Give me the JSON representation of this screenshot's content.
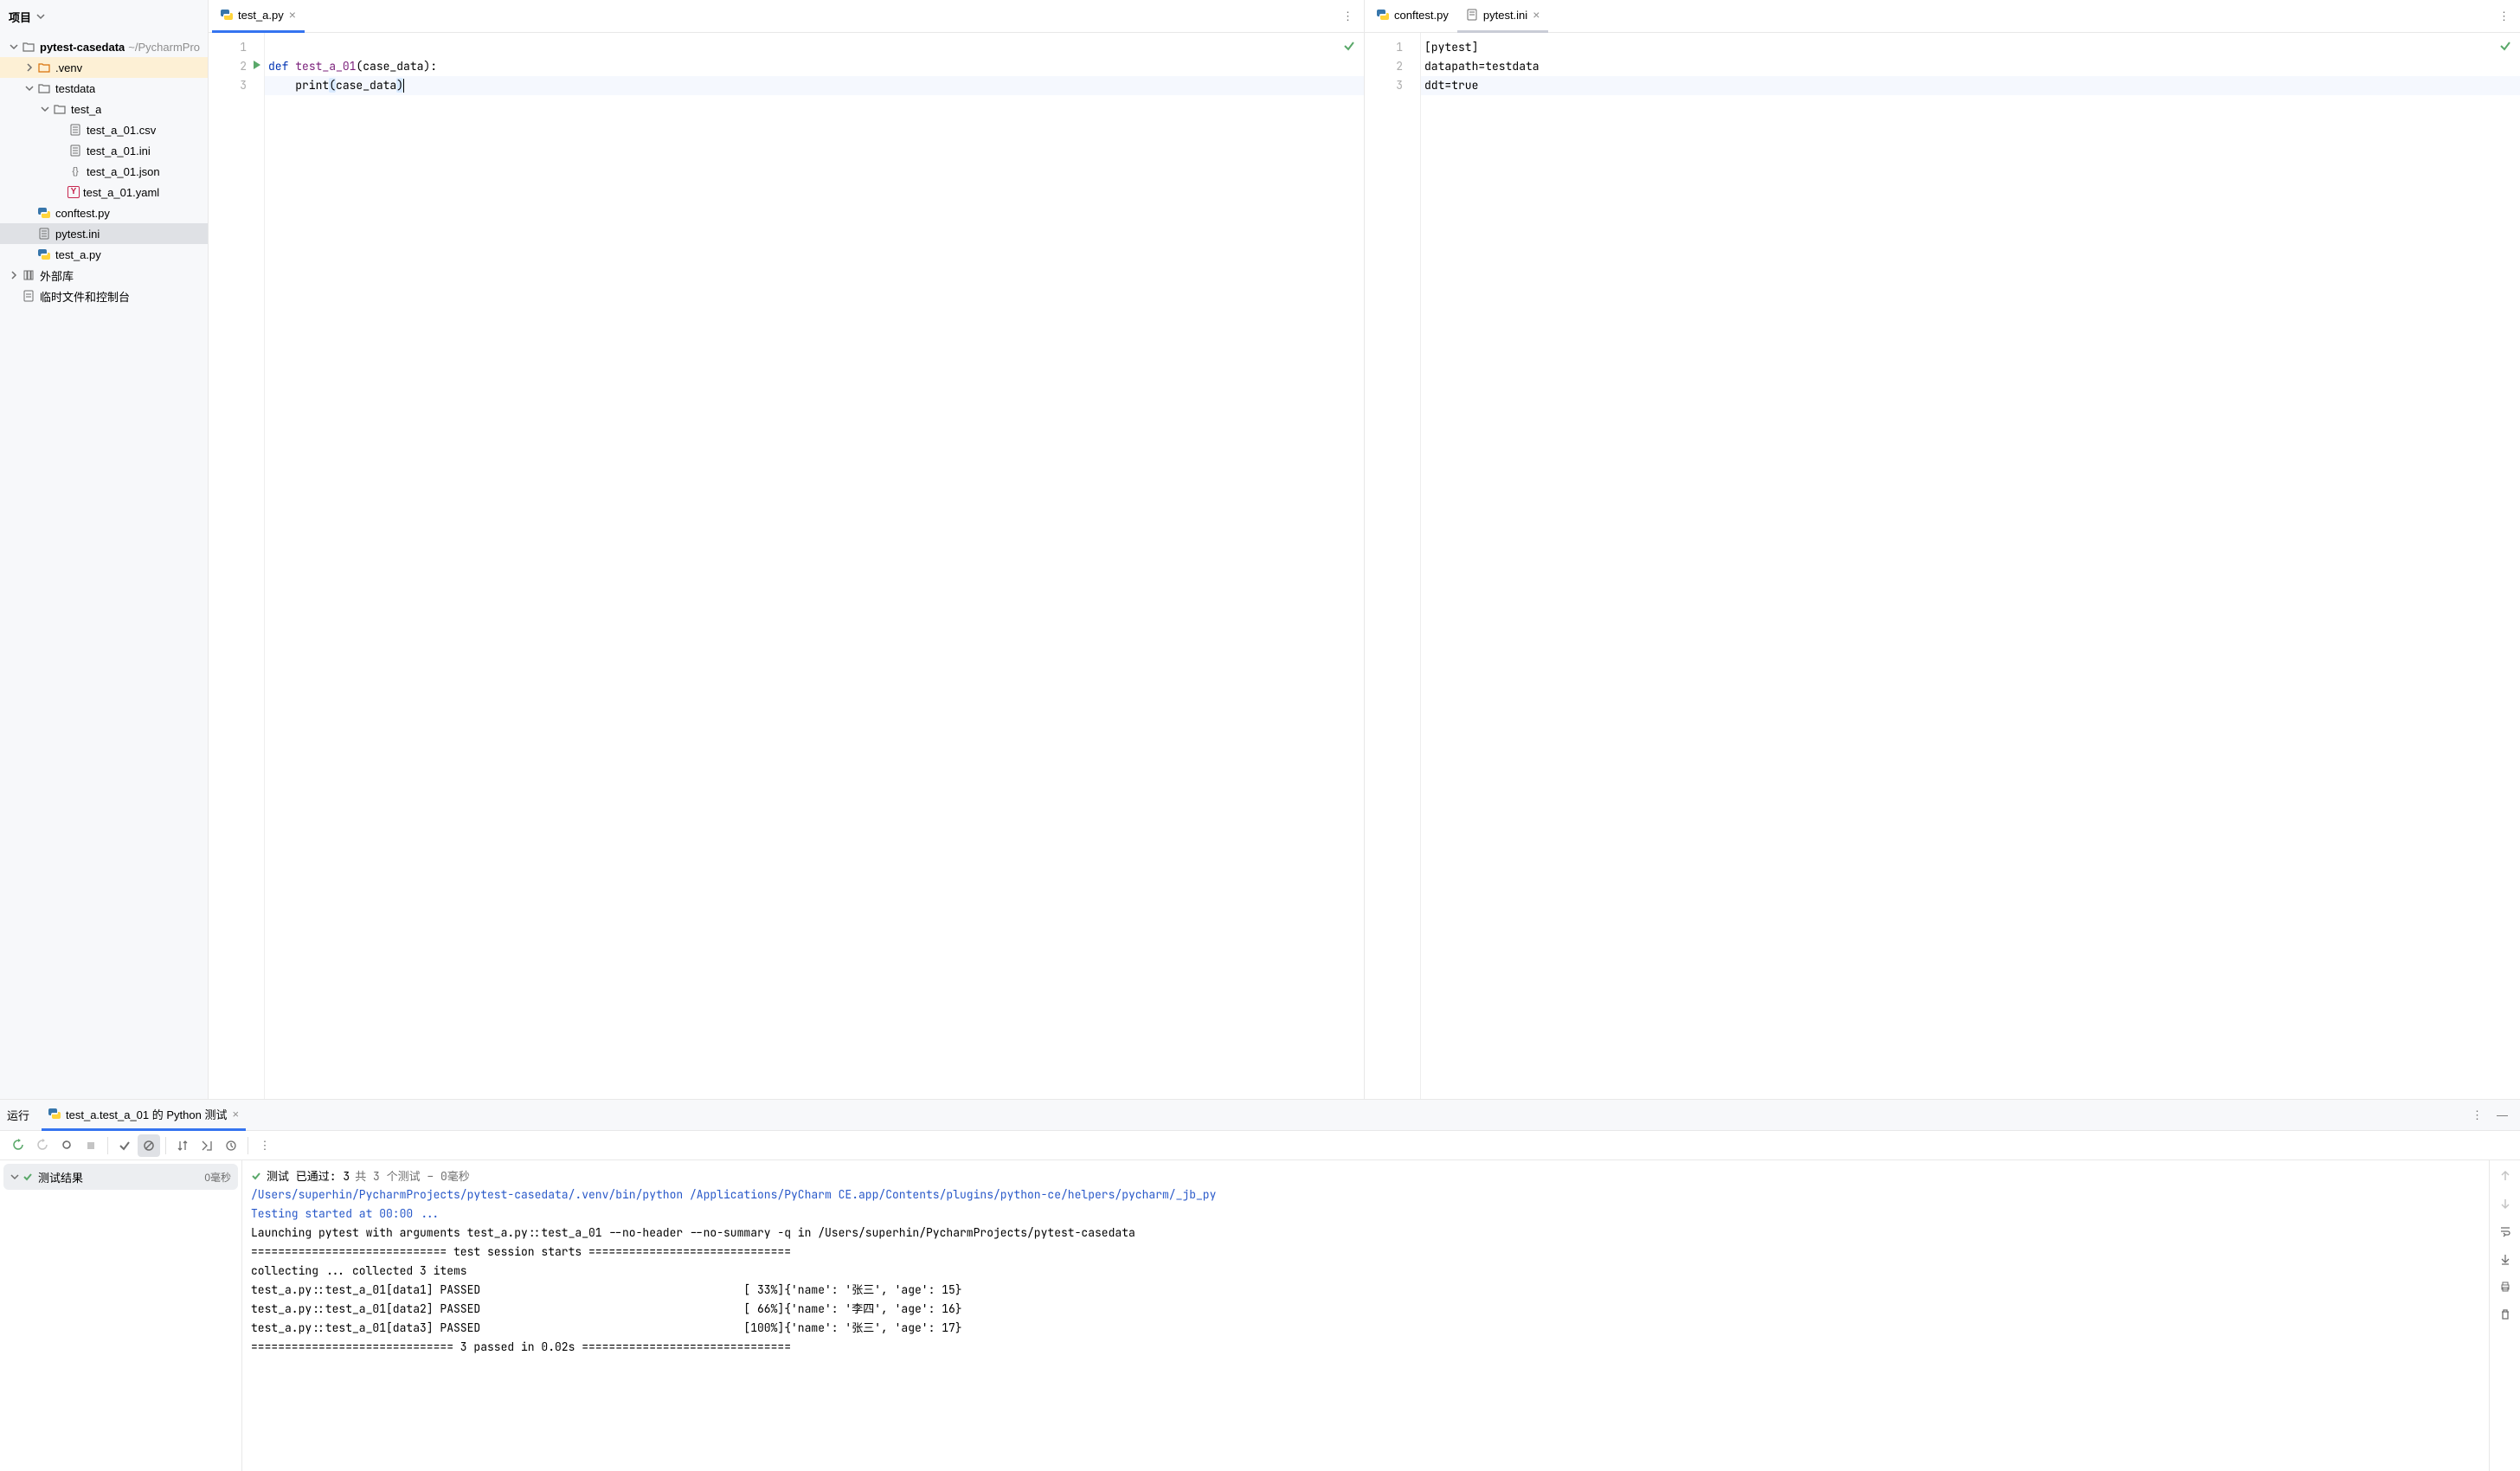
{
  "sidebar": {
    "title": "项目",
    "root": {
      "name": "pytest-casedata",
      "path": "~/PycharmPro"
    },
    "items": [
      {
        "label": ".venv"
      },
      {
        "label": "testdata"
      },
      {
        "label": "test_a"
      },
      {
        "label": "test_a_01.csv"
      },
      {
        "label": "test_a_01.ini"
      },
      {
        "label": "test_a_01.json"
      },
      {
        "label": "test_a_01.yaml"
      },
      {
        "label": "conftest.py"
      },
      {
        "label": "pytest.ini"
      },
      {
        "label": "test_a.py"
      },
      {
        "label": "外部库"
      },
      {
        "label": "临时文件和控制台"
      }
    ]
  },
  "editor_left": {
    "tab": "test_a.py",
    "lines": {
      "l1_num": "1",
      "l2_num": "2",
      "l3_num": "3",
      "l2_def": "def",
      "l2_fn": "test_a_01",
      "l2_args": "(case_data):",
      "l3_print": "print",
      "l3_open": "(",
      "l3_arg": "case_data",
      "l3_close": ")"
    }
  },
  "editor_right": {
    "tab1": "conftest.py",
    "tab2": "pytest.ini",
    "lines": {
      "l1_num": "1",
      "l1": "[pytest]",
      "l2_num": "2",
      "l2": "datapath=testdata",
      "l3_num": "3",
      "l3": "ddt=true"
    }
  },
  "run": {
    "title": "运行",
    "tab": "test_a.test_a_01 的 Python 测试",
    "results_label": "测试结果",
    "results_time": "0毫秒",
    "status_prefix": "测试 已通过: 3",
    "status_suffix": "共 3 个测试 – 0毫秒",
    "console": [
      {
        "cls": "blue",
        "text": "/Users/superhin/PycharmProjects/pytest-casedata/.venv/bin/python /Applications/PyCharm CE.app/Contents/plugins/python-ce/helpers/pycharm/_jb_py"
      },
      {
        "cls": "blue",
        "text": "Testing started at 00:00 ..."
      },
      {
        "cls": "",
        "text": "Launching pytest with arguments test_a.py::test_a_01 --no-header --no-summary -q in /Users/superhin/PycharmProjects/pytest-casedata"
      },
      {
        "cls": "",
        "text": ""
      },
      {
        "cls": "",
        "text": "============================= test session starts =============================="
      },
      {
        "cls": "",
        "text": "collecting ... collected 3 items"
      },
      {
        "cls": "",
        "text": ""
      },
      {
        "cls": "",
        "text": "test_a.py::test_a_01[data1] PASSED                                       [ 33%]{'name': '张三', 'age': 15}"
      },
      {
        "cls": "",
        "text": ""
      },
      {
        "cls": "",
        "text": "test_a.py::test_a_01[data2] PASSED                                       [ 66%]{'name': '李四', 'age': 16}"
      },
      {
        "cls": "",
        "text": ""
      },
      {
        "cls": "",
        "text": "test_a.py::test_a_01[data3] PASSED                                       [100%]{'name': '张三', 'age': 17}"
      },
      {
        "cls": "",
        "text": ""
      },
      {
        "cls": "",
        "text": ""
      },
      {
        "cls": "",
        "text": "============================== 3 passed in 0.02s ==============================="
      }
    ]
  }
}
